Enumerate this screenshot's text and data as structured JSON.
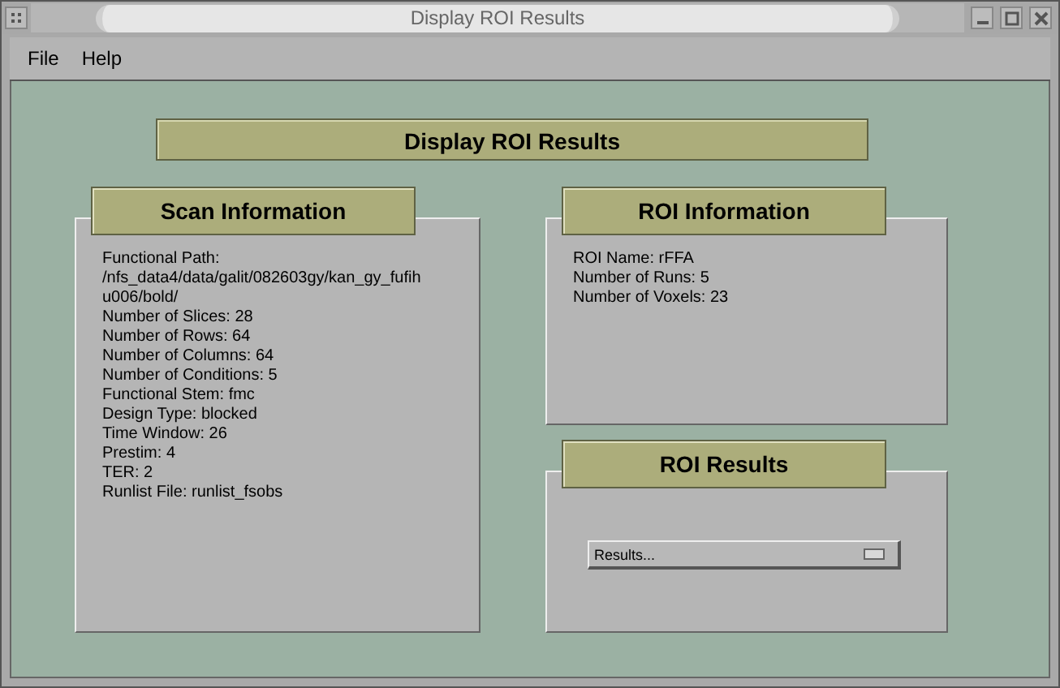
{
  "window": {
    "title": "Display ROI Results"
  },
  "menu": [
    {
      "label": "File"
    },
    {
      "label": "Help"
    }
  ],
  "banner": "Display ROI Results",
  "scan_information": {
    "title": "Scan Information",
    "lines": [
      "Functional Path:",
      "/nfs_data4/data/galit/082603gy/kan_gy_fufih",
      "u006/bold/",
      "Number of Slices: 28",
      "Number of Rows: 64",
      "Number of Columns: 64",
      "Number of Conditions: 5",
      "Functional Stem: fmc",
      "Design Type: blocked",
      "Time Window: 26",
      "Prestim: 4",
      "TER: 2",
      "Runlist File: runlist_fsobs"
    ]
  },
  "roi_information": {
    "title": "ROI Information",
    "lines": [
      "ROI Name: rFFA",
      "Number of Runs: 5",
      "Number of Voxels: 23"
    ]
  },
  "roi_results": {
    "title": "ROI Results",
    "dropdown": {
      "value": "Results..."
    }
  }
}
